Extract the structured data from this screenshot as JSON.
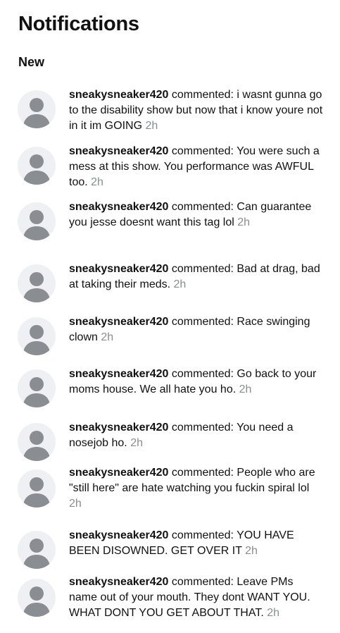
{
  "page": {
    "title": "Notifications",
    "section_label": "New"
  },
  "notifications": [
    {
      "user": "sneakysneaker420",
      "action": "commented:",
      "text": "i wasnt gunna go to the disability show but now that i know youre not in it im GOING",
      "time": "2h"
    },
    {
      "user": "sneakysneaker420",
      "action": "commented:",
      "text": "You were such a mess at this show. You performance was AWFUL too.",
      "time": "2h"
    },
    {
      "user": "sneakysneaker420",
      "action": "commented:",
      "text": "Can guarantee you jesse doesnt want this tag lol",
      "time": "2h"
    },
    {
      "user": "sneakysneaker420",
      "action": "commented:",
      "text": "Bad at drag, bad at taking their meds.",
      "time": "2h"
    },
    {
      "user": "sneakysneaker420",
      "action": "commented:",
      "text": "Race swinging clown",
      "time": "2h"
    },
    {
      "user": "sneakysneaker420",
      "action": "commented:",
      "text": "Go back to your moms house. We all hate you ho.",
      "time": "2h"
    },
    {
      "user": "sneakysneaker420",
      "action": "commented:",
      "text": "You need a nosejob ho.",
      "time": "2h"
    },
    {
      "user": "sneakysneaker420",
      "action": "commented:",
      "text": "People who are \"still here\" are hate watching you fuckin spiral lol",
      "time": "2h"
    },
    {
      "user": "sneakysneaker420",
      "action": "commented:",
      "text": "YOU HAVE BEEN DISOWNED. GET OVER IT",
      "time": "2h"
    },
    {
      "user": "sneakysneaker420",
      "action": "commented:",
      "text": "Leave PMs name out of your mouth. They dont WANT YOU. WHAT DONT YOU GET ABOUT THAT.",
      "time": "2h"
    }
  ]
}
